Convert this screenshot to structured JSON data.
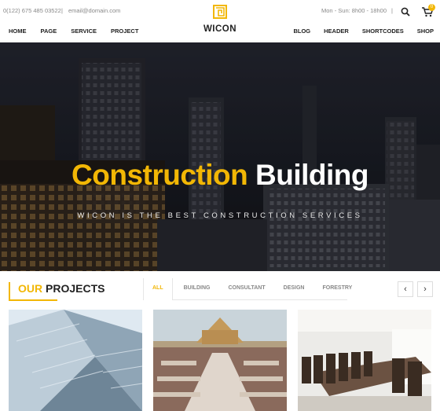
{
  "topbar": {
    "phone": "0(122) 675 485 03522",
    "email": "email@domain.com",
    "hours": "Mon - Sun: 8h00 - 18h00",
    "separator": "|",
    "cart_count": "0"
  },
  "brand": {
    "name": "WICON"
  },
  "nav": {
    "left": [
      "HOME",
      "PAGE",
      "SERVICE",
      "PROJECT"
    ],
    "right": [
      "BLOG",
      "HEADER",
      "SHORTCODES",
      "SHOP"
    ]
  },
  "hero": {
    "title_accent": "Construction",
    "title_rest": "Building",
    "subtitle": "WICON IS THE BEST CONSTRUCTION SERVICES"
  },
  "projects": {
    "title_accent": "OUR",
    "title_rest": "PROJECTS",
    "filters": [
      "ALL",
      "BUILDING",
      "CONSULTANT",
      "DESIGN",
      "FORESTRY"
    ],
    "active_filter": "ALL",
    "prev_label": "‹",
    "next_label": "›"
  },
  "colors": {
    "accent": "#f2b705",
    "text": "#222222"
  },
  "icons": {
    "search": "search-icon",
    "cart": "cart-icon",
    "logo": "logo-icon"
  }
}
